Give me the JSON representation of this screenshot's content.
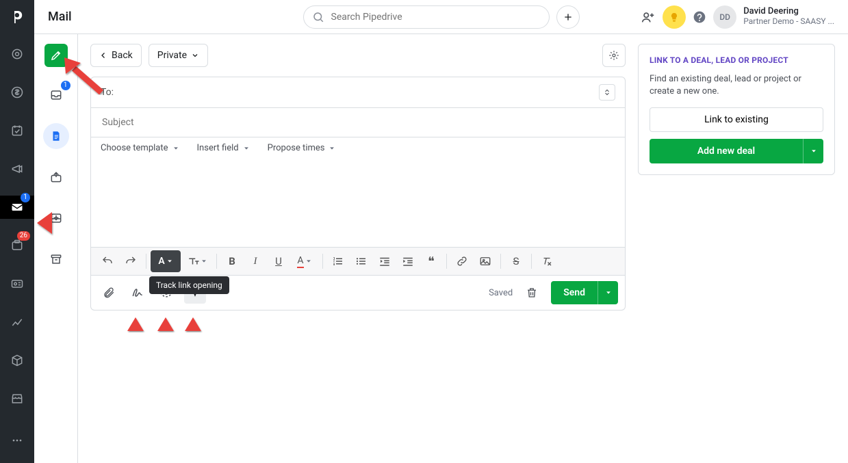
{
  "app": {
    "title": "Mail"
  },
  "search": {
    "placeholder": "Search Pipedrive"
  },
  "user": {
    "initials": "DD",
    "name": "David Deering",
    "org": "Partner Demo - SAASY ..."
  },
  "rail": {
    "mail_badge": "1",
    "projects_badge": "26"
  },
  "mailrail": {
    "inbox_badge": "1"
  },
  "composer": {
    "back": "Back",
    "visibility": "Private",
    "to_label": "To:",
    "subject_placeholder": "Subject",
    "template": "Choose template",
    "insert_field": "Insert field",
    "propose": "Propose times",
    "saved": "Saved",
    "send": "Send"
  },
  "tooltip": "Track link opening",
  "sidepanel": {
    "title": "LINK TO A DEAL, LEAD OR PROJECT",
    "text": "Find an existing deal, lead or project or create a new one.",
    "link_btn": "Link to existing",
    "add_btn": "Add new deal"
  }
}
